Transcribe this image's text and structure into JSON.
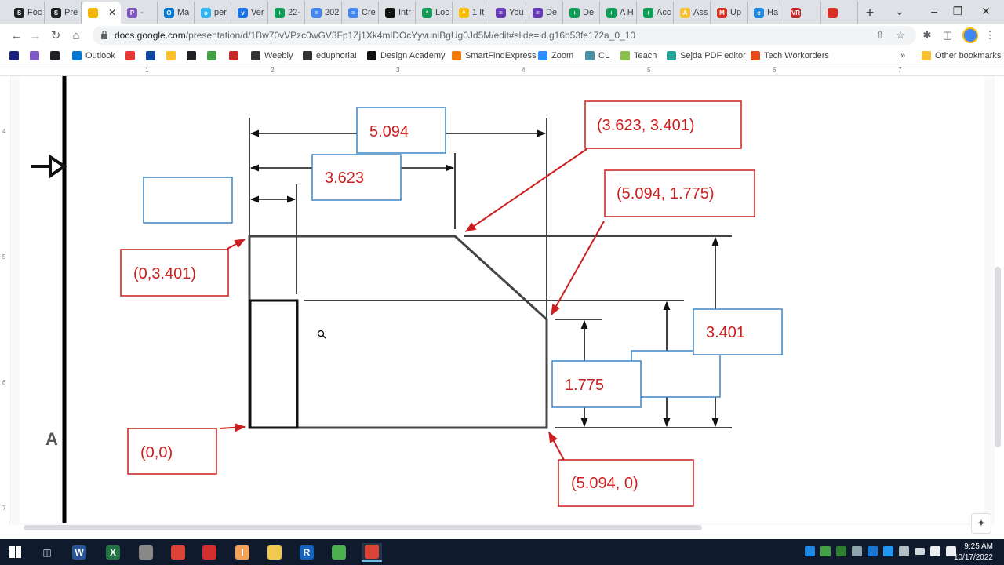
{
  "browser": {
    "tabs": [
      {
        "label": "Foc",
        "color": "#202124",
        "glyph": "S"
      },
      {
        "label": "Pre",
        "color": "#202124",
        "glyph": "S"
      },
      {
        "label": "",
        "color": "#f4b400",
        "glyph": "",
        "active": true
      },
      {
        "label": "-",
        "color": "#7e57c2",
        "glyph": "P"
      },
      {
        "label": "Ma",
        "color": "#0078d4",
        "glyph": "O"
      },
      {
        "label": "per",
        "color": "#29b6f6",
        "glyph": "o"
      },
      {
        "label": "Ver",
        "color": "#1a73e8",
        "glyph": "v"
      },
      {
        "label": "22-",
        "color": "#0f9d58",
        "glyph": "+"
      },
      {
        "label": "202",
        "color": "#4285f4",
        "glyph": "="
      },
      {
        "label": "Cre",
        "color": "#4285f4",
        "glyph": "="
      },
      {
        "label": "Intr",
        "color": "#111111",
        "glyph": "~"
      },
      {
        "label": "Loc",
        "color": "#0f9d58",
        "glyph": "*"
      },
      {
        "label": "1 It",
        "color": "#fbbc04",
        "glyph": "^"
      },
      {
        "label": "You",
        "color": "#673ab7",
        "glyph": "="
      },
      {
        "label": "De",
        "color": "#673ab7",
        "glyph": "="
      },
      {
        "label": "De",
        "color": "#0f9d58",
        "glyph": "+"
      },
      {
        "label": "A H",
        "color": "#0f9d58",
        "glyph": "+"
      },
      {
        "label": "Acc",
        "color": "#0f9d58",
        "glyph": "+"
      },
      {
        "label": "Ass",
        "color": "#fbc02d",
        "glyph": "A"
      },
      {
        "label": "Up",
        "color": "#d93025",
        "glyph": "M"
      },
      {
        "label": "Ha",
        "color": "#1e88e5",
        "glyph": "c"
      },
      {
        "label": "",
        "color": "#c62828",
        "glyph": "VR"
      },
      {
        "label": "",
        "color": "#d93025",
        "glyph": ""
      }
    ],
    "url_host": "docs.google.com",
    "url_path": "/presentation/d/1Bw70vVPzc0wGV3Fp1Zj1Xk4mlDOcYyvuniBgUg0Jd5M/edit#slide=id.g16b53fe172a_0_10",
    "bookmarks": [
      {
        "label": "",
        "color": "#1a237e"
      },
      {
        "label": "",
        "color": "#7e57c2"
      },
      {
        "label": "",
        "color": "#202124"
      },
      {
        "label": "Outlook",
        "color": "#0078d4"
      },
      {
        "label": "",
        "color": "#e53935"
      },
      {
        "label": "",
        "color": "#0d47a1"
      },
      {
        "label": "",
        "color": "#fbc02d"
      },
      {
        "label": "",
        "color": "#202124"
      },
      {
        "label": "",
        "color": "#43a047"
      },
      {
        "label": "",
        "color": "#c62828"
      },
      {
        "label": "Weebly",
        "color": "#333333"
      },
      {
        "label": "eduphoria!",
        "color": "#333333"
      },
      {
        "label": "Design Academy",
        "color": "#111111"
      },
      {
        "label": "SmartFindExpress",
        "color": "#f57c00"
      },
      {
        "label": "Zoom",
        "color": "#2d8cff"
      },
      {
        "label": "CL",
        "color": "#4a90a4"
      },
      {
        "label": "Teach",
        "color": "#8bc34a"
      },
      {
        "label": "Sejda PDF editor",
        "color": "#26a69a"
      },
      {
        "label": "Tech Workorders",
        "color": "#e64a19"
      }
    ],
    "more_bookmarks": "»",
    "other_bookmarks": "Other bookmarks"
  },
  "ruler": {
    "h_numbers": [
      "1",
      "2",
      "3",
      "4",
      "5",
      "6",
      "7"
    ],
    "v_numbers": [
      "4",
      "5",
      "6",
      "7"
    ]
  },
  "slide": {
    "datum_letter": "A",
    "blue_labels": {
      "dim_5094": "5.094",
      "dim_3623": "3.623",
      "dim_blank_left": "",
      "dim_3401": "3.401",
      "dim_1775": "1.775",
      "dim_blank_right": ""
    },
    "red_labels": {
      "pt_3623_3401": "(3.623, 3.401)",
      "pt_5094_1775": "(5.094, 1.775)",
      "pt_0_3401": "(0,3.401)",
      "pt_0_0": "(0,0)",
      "pt_5094_0": "(5.094, 0)"
    },
    "colors": {
      "red": "#cc1f1f",
      "blue": "#3d85c6",
      "line": "#444444"
    }
  },
  "taskbar": {
    "apps": [
      {
        "glyph": "W",
        "color": "#2b579a"
      },
      {
        "glyph": "X",
        "color": "#217346"
      },
      {
        "glyph": "",
        "color": "#888888"
      },
      {
        "glyph": "",
        "color": "#db4437"
      },
      {
        "glyph": "",
        "color": "#d32f2f"
      },
      {
        "glyph": "I",
        "color": "#f4a259"
      },
      {
        "glyph": "",
        "color": "#f2c94c"
      },
      {
        "glyph": "R",
        "color": "#1565c0"
      },
      {
        "glyph": "",
        "color": "#4caf50"
      },
      {
        "glyph": "",
        "color": "#db4437"
      }
    ],
    "time": "9:25 AM",
    "date": "10/17/2022"
  }
}
